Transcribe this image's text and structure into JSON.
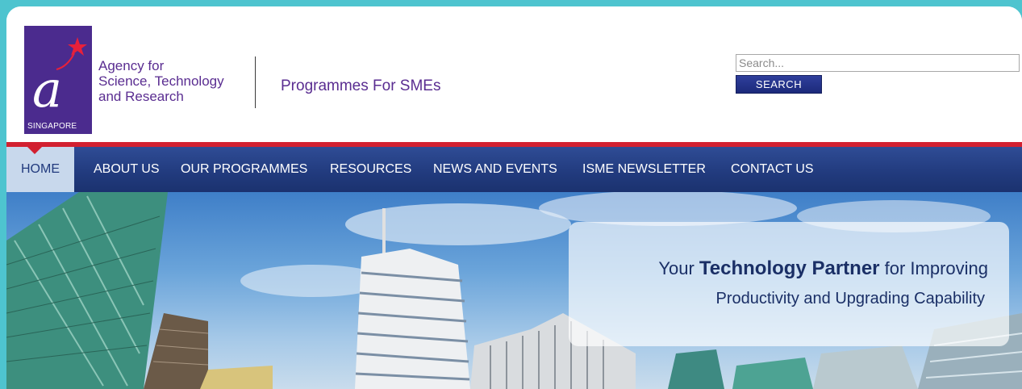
{
  "header": {
    "logo": {
      "letter": "a",
      "country": "SINGAPORE"
    },
    "agency_name": {
      "line1": "Agency for",
      "line2": "Science, Technology",
      "line3": "and Research"
    },
    "site_title": "Programmes For SMEs",
    "search": {
      "placeholder": "Search...",
      "value": "",
      "button_label": "SEARCH"
    }
  },
  "nav": {
    "items": [
      {
        "label": "HOME",
        "active": true
      },
      {
        "label": "ABOUT US",
        "active": false
      },
      {
        "label": "OUR PROGRAMMES",
        "active": false
      },
      {
        "label": "RESOURCES",
        "active": false
      },
      {
        "label": "NEWS AND EVENTS",
        "active": false
      },
      {
        "label": "ISME NEWSLETTER",
        "active": false
      },
      {
        "label": "CONTACT US",
        "active": false
      }
    ]
  },
  "hero": {
    "tagline_part1": "Your ",
    "tagline_strong": "Technology Partner",
    "tagline_part2": " for Improving",
    "tagline_line2": "Productivity and Upgrading Capability"
  },
  "colors": {
    "page_background": "#4ec4cf",
    "brand_purple": "#4b2b8e",
    "nav_blue": "#213a7d",
    "accent_red": "#d22030",
    "active_tab": "#c8d8ec"
  }
}
